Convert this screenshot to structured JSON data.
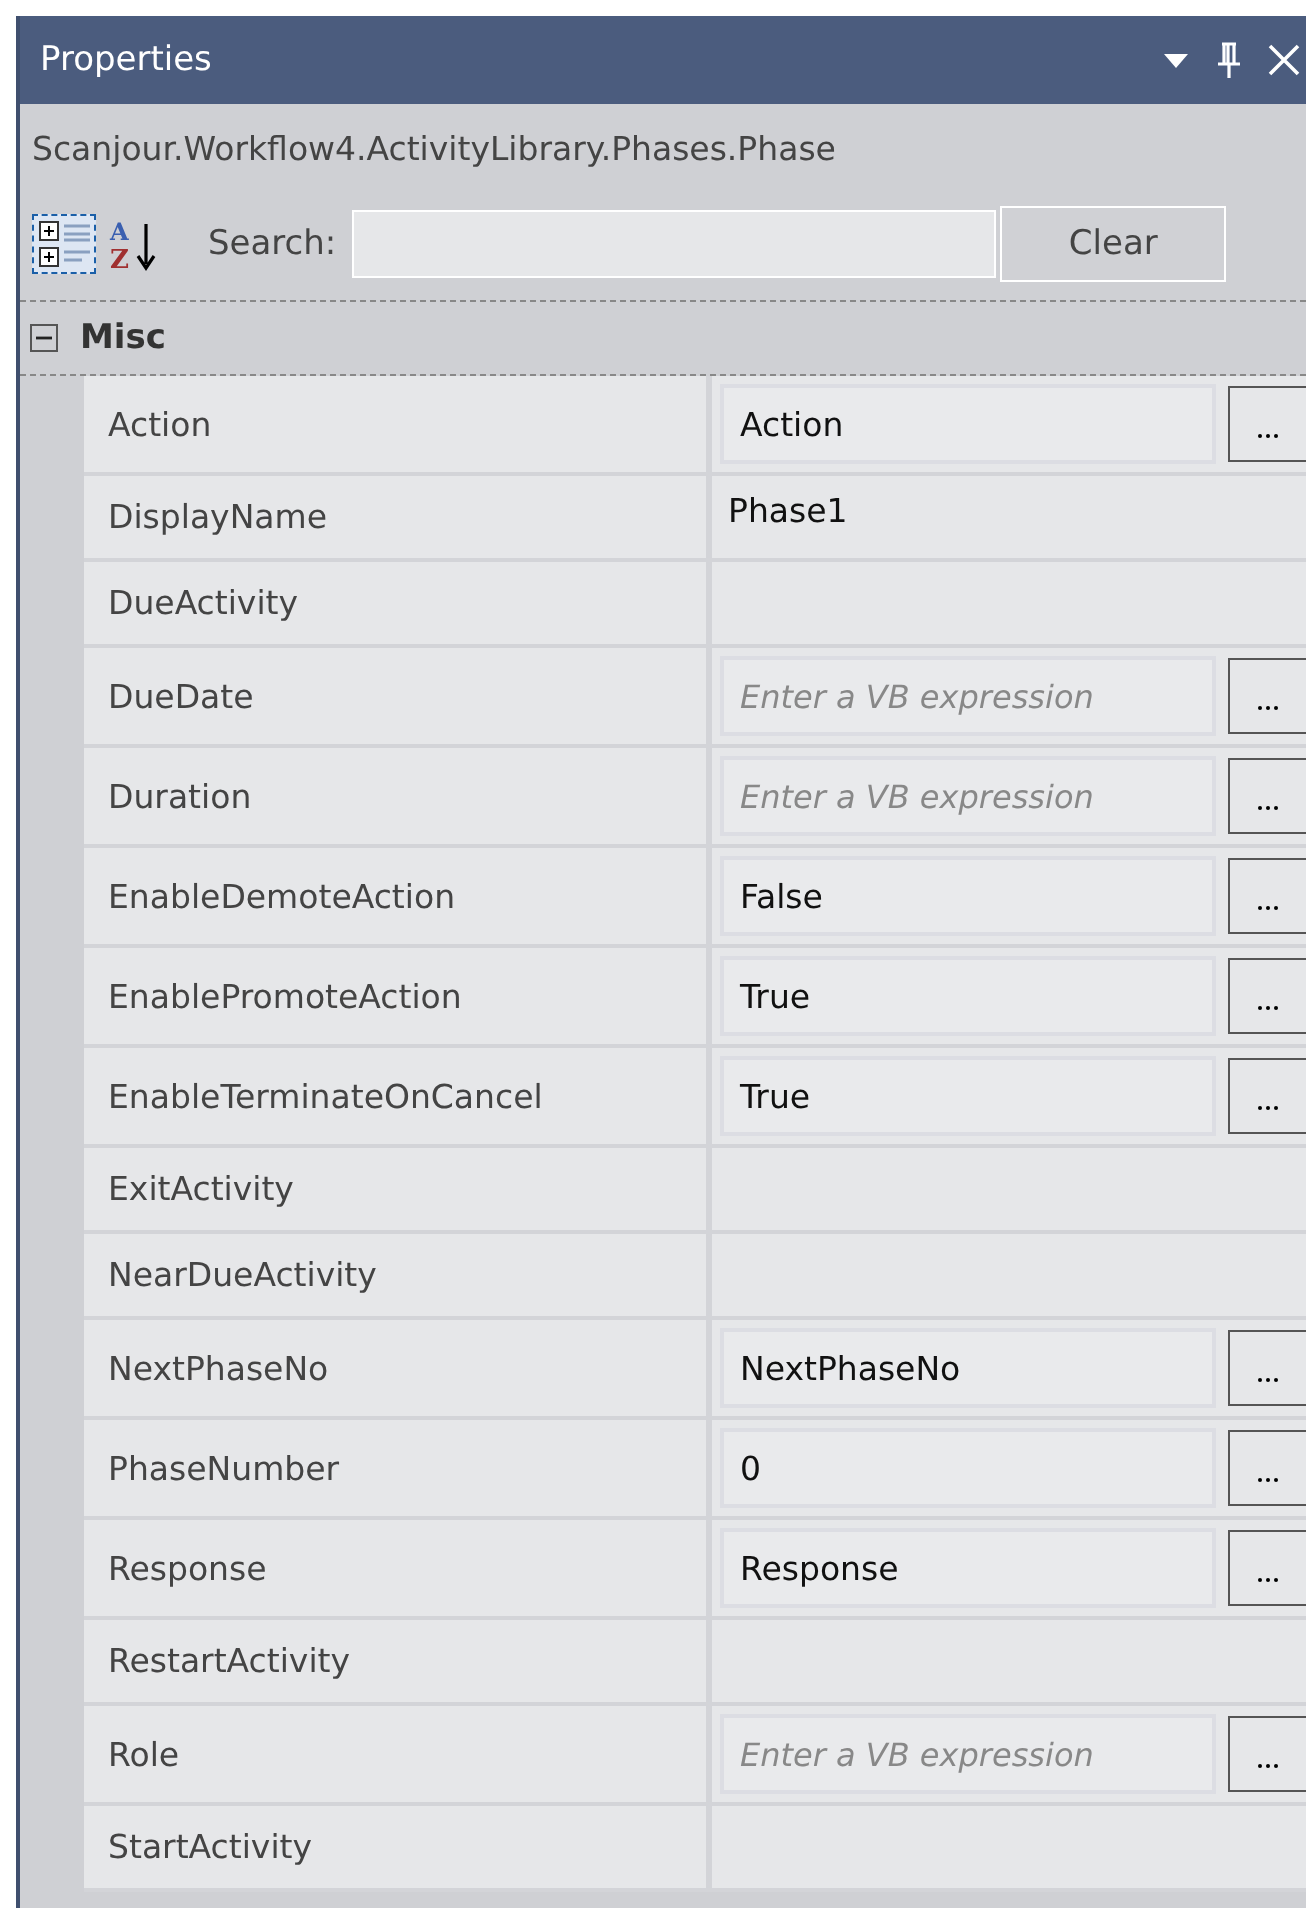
{
  "window": {
    "title": "Properties"
  },
  "object_type": "Scanjour.Workflow4.ActivityLibrary.Phases.Phase",
  "toolbar": {
    "sort_buttons": [
      {
        "kind": "categorized",
        "selected": true
      },
      {
        "kind": "alphabetical",
        "selected": false,
        "letters": [
          "A",
          "Z"
        ]
      }
    ],
    "search_label": "Search:",
    "clear_button": "Clear"
  },
  "category": {
    "name": "Misc",
    "expanded": true,
    "properties": [
      {
        "name": "Action",
        "kind": "editor",
        "value": "Action"
      },
      {
        "name": "DisplayName",
        "kind": "text",
        "value": "Phase1"
      },
      {
        "name": "DueActivity",
        "kind": "empty"
      },
      {
        "name": "DueDate",
        "kind": "editor",
        "placeholder": "Enter a VB expression"
      },
      {
        "name": "Duration",
        "kind": "editor",
        "placeholder": "Enter a VB expression"
      },
      {
        "name": "EnableDemoteAction",
        "kind": "editor",
        "value": "False"
      },
      {
        "name": "EnablePromoteAction",
        "kind": "editor",
        "value": "True"
      },
      {
        "name": "EnableTerminateOnCancel",
        "kind": "editor",
        "value": "True"
      },
      {
        "name": "ExitActivity",
        "kind": "empty"
      },
      {
        "name": "NearDueActivity",
        "kind": "empty"
      },
      {
        "name": "NextPhaseNo",
        "kind": "editor",
        "value": "NextPhaseNo"
      },
      {
        "name": "PhaseNumber",
        "kind": "editor",
        "value": "0"
      },
      {
        "name": "Response",
        "kind": "editor",
        "value": "Response"
      },
      {
        "name": "RestartActivity",
        "kind": "empty"
      },
      {
        "name": "Role",
        "kind": "editor",
        "placeholder": "Enter a VB expression"
      },
      {
        "name": "StartActivity",
        "kind": "empty"
      }
    ]
  }
}
